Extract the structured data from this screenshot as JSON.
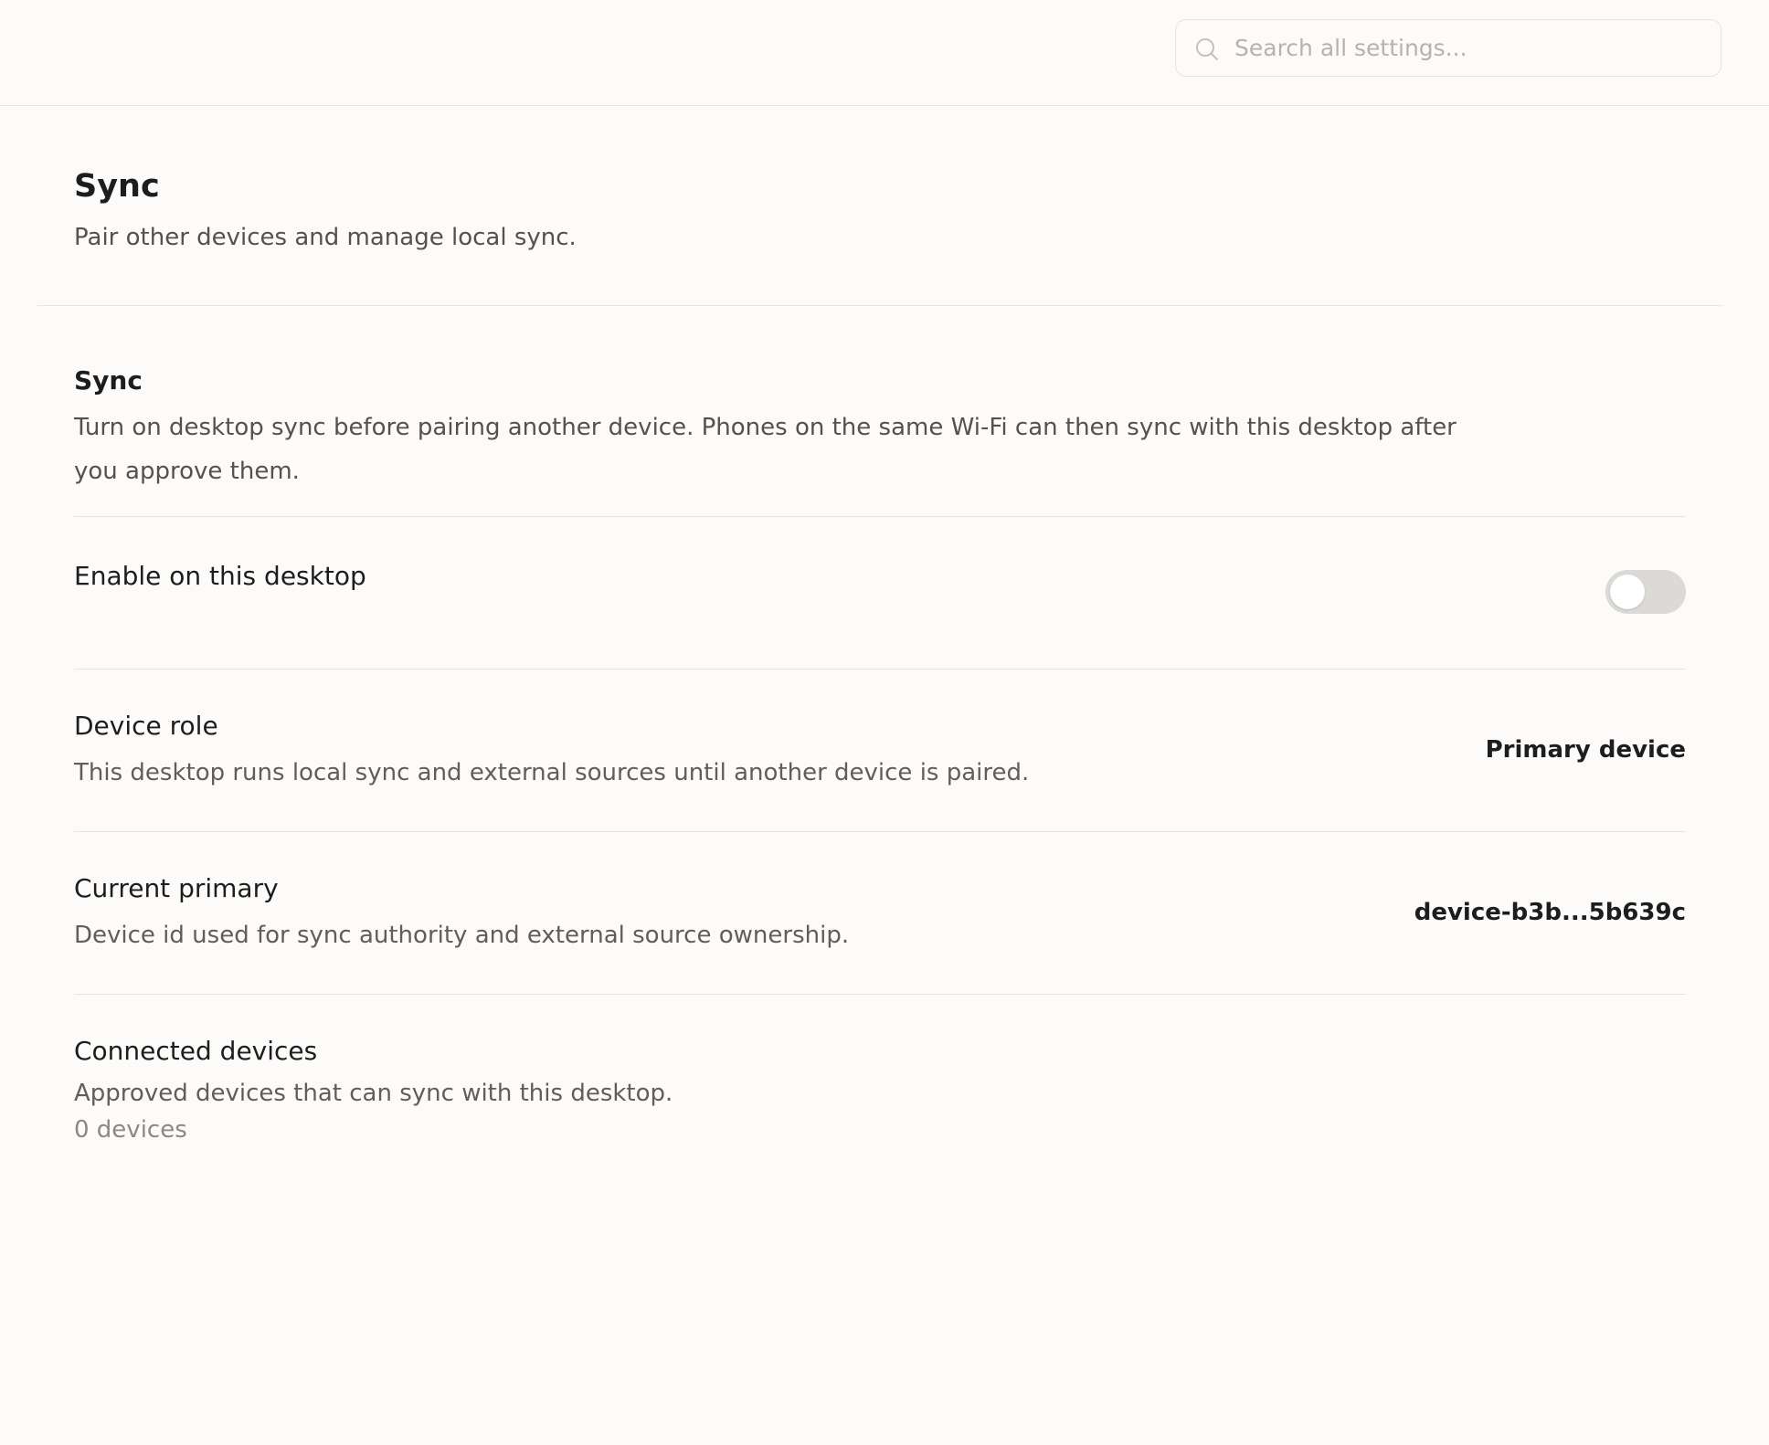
{
  "search": {
    "placeholder": "Search all settings...",
    "icon": "search-icon"
  },
  "header": {
    "title": "Sync",
    "subtitle": "Pair other devices and manage local sync."
  },
  "section": {
    "title": "Sync",
    "description": "Turn on desktop sync before pairing another device. Phones on the same Wi-Fi can then sync with this desktop after you approve them."
  },
  "rows": {
    "enable": {
      "label": "Enable on this desktop",
      "enabled": false
    },
    "device_role": {
      "label": "Device role",
      "description": "This desktop runs local sync and external sources until another device is paired.",
      "value": "Primary device"
    },
    "current_primary": {
      "label": "Current primary",
      "description": "Device id used for sync authority and external source ownership.",
      "value": "device-b3b...5b639c"
    },
    "connected_devices": {
      "label": "Connected devices",
      "description": "Approved devices that can sync with this desktop.",
      "count": "0 devices"
    }
  },
  "colors": {
    "background": "#fcfbf9",
    "divider": "#e8e6e3",
    "toggle_off": "#dcdad7"
  }
}
